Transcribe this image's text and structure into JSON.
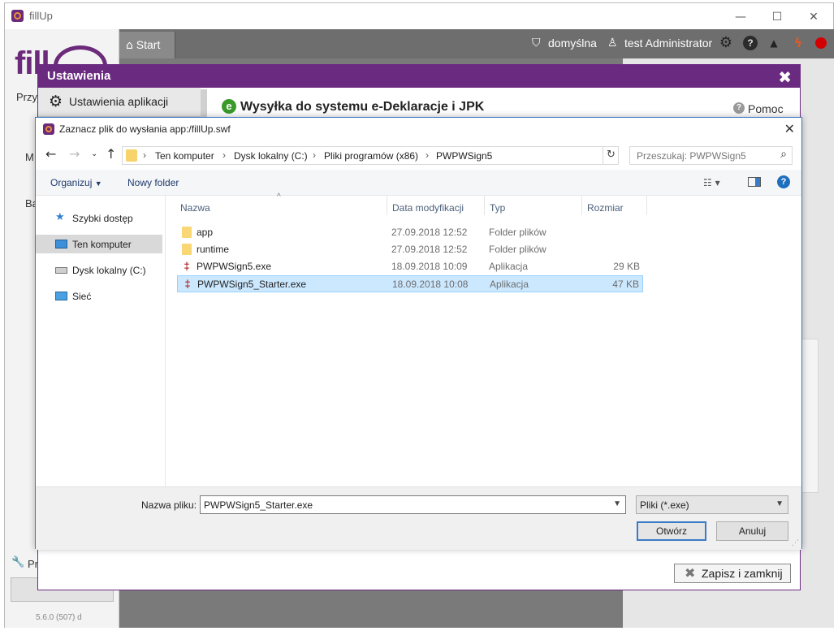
{
  "app": {
    "title": "fillUp",
    "logo_text": "fill",
    "sidebar_fragments": [
      "Przyj",
      "M",
      "Ba",
      "Pr"
    ],
    "version": "5.6.0 (507) d",
    "window_controls": {
      "minimize": "—",
      "maximize": "☐",
      "close": "✕"
    }
  },
  "topbar": {
    "start_label": "Start",
    "profile_label": "domyślna",
    "user_label": "test Administrator",
    "icons": [
      "gear-icon",
      "help-icon",
      "cloud-upload-icon",
      "power-icon",
      "record-icon"
    ],
    "colors": {
      "power": "#e05a2a",
      "record": "#d40000"
    }
  },
  "settings": {
    "title": "Ustawienia",
    "close_glyph": "✖",
    "nav_item": "Ustawienia aplikacji",
    "section_title": "Wysyłka do systemu e-Deklaracje i JPK",
    "help_label": "Pomoc",
    "save_close_label": "Zapisz i zamknij",
    "accent_color": "#6a2a80"
  },
  "file_dialog": {
    "title": "Zaznacz plik do wysłania app:/fillUp.swf",
    "breadcrumb": [
      "Ten komputer",
      "Dysk lokalny (C:)",
      "Pliki programów (x86)",
      "PWPWSign5"
    ],
    "search_placeholder": "Przeszukaj: PWPWSign5",
    "toolbar": {
      "organize": "Organizuj",
      "new_folder": "Nowy folder"
    },
    "nav_pane": [
      {
        "label": "Szybki dostęp",
        "icon": "star-icon"
      },
      {
        "label": "Ten komputer",
        "icon": "computer-icon",
        "selected": true
      },
      {
        "label": "Dysk lokalny (C:)",
        "icon": "drive-icon"
      },
      {
        "label": "Sieć",
        "icon": "network-icon"
      }
    ],
    "columns": [
      "Nazwa",
      "Data modyfikacji",
      "Typ",
      "Rozmiar"
    ],
    "files": [
      {
        "name": "app",
        "date": "27.09.2018 12:52",
        "type": "Folder plików",
        "size": "",
        "icon": "folder-icon"
      },
      {
        "name": "runtime",
        "date": "27.09.2018 12:52",
        "type": "Folder plików",
        "size": "",
        "icon": "folder-icon"
      },
      {
        "name": "PWPWSign5.exe",
        "date": "18.09.2018 10:09",
        "type": "Aplikacja",
        "size": "29 KB",
        "icon": "exe-icon"
      },
      {
        "name": "PWPWSign5_Starter.exe",
        "date": "18.09.2018 10:08",
        "type": "Aplikacja",
        "size": "47 KB",
        "icon": "exe-icon",
        "selected": true
      }
    ],
    "filename_label": "Nazwa pliku:",
    "filename_value": "PWPWSign5_Starter.exe",
    "filetype_value": "Pliki (*.exe)",
    "open_label": "Otwórz",
    "cancel_label": "Anuluj"
  }
}
